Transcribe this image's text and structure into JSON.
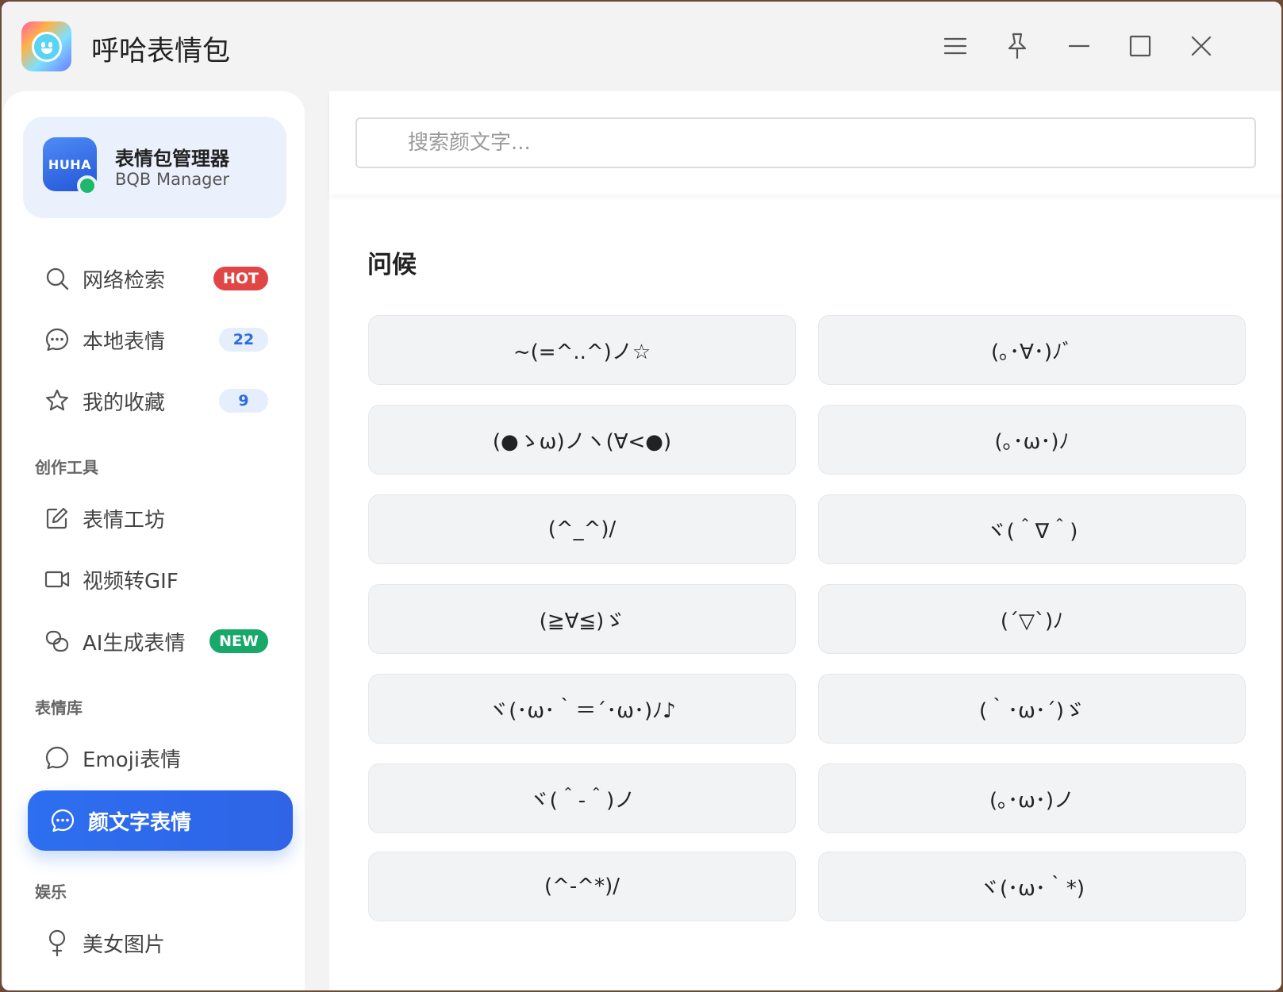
{
  "app": {
    "title": "呼哈表情包"
  },
  "titlebar": {
    "buttons": [
      "menu-icon",
      "pin-icon",
      "minimize-icon",
      "maximize-icon",
      "close-icon"
    ]
  },
  "profile": {
    "avatar_text": "HUHA",
    "name": "表情包管理器",
    "subtitle": "BQB Manager",
    "status_color": "#1db86b"
  },
  "sidebar": {
    "items": [
      {
        "label": "网络检索",
        "icon": "search-icon",
        "badge": "HOT"
      },
      {
        "label": "本地表情",
        "icon": "chat-dots-icon",
        "badge": "22"
      },
      {
        "label": "我的收藏",
        "icon": "star-icon",
        "badge": "9"
      },
      {
        "label": "表情工坊",
        "icon": "edit-icon"
      },
      {
        "label": "视频转GIF",
        "icon": "video-icon"
      },
      {
        "label": "AI生成表情",
        "icon": "ai-link-icon",
        "badge": "NEW"
      },
      {
        "label": "Emoji表情",
        "icon": "chat-bubble-icon"
      },
      {
        "label": "颜文字表情",
        "icon": "chat-dots-icon",
        "active": true
      },
      {
        "label": "美女图片",
        "icon": "female-icon"
      }
    ],
    "sections": [
      "创作工具",
      "表情库",
      "娱乐"
    ]
  },
  "search": {
    "placeholder": "搜索颜文字..."
  },
  "category": {
    "title": "问候",
    "kaomoji": [
      "~(=^..^)ノ☆",
      "(｡･∀･)ﾉﾞ",
      "(●ゝω)ノヽ(∀<●)",
      "(｡･ω･)ﾉ",
      "(^_^)/",
      "ヾ(＾∇＾)",
      "(≧∀≦)ゞ",
      "(´▽`)ﾉ",
      "ヾ(･ω･｀＝´･ω･)ﾉ♪",
      "(｀･ω･´)ゞ",
      "ヾ(＾-＾)ノ",
      "(｡･ω･)ノ",
      "(^-^*)/",
      "ヾ(･ω･｀*)"
    ]
  },
  "colors": {
    "accent": "#2d6ff0",
    "hot": "#e04646",
    "new": "#17a86a"
  }
}
